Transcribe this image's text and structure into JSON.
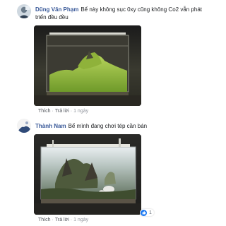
{
  "comments": [
    {
      "author": "Dũng Văn Phạm",
      "text": "Bể này không sục 0xy cũng không Co2 vẫn phát triển đều đều",
      "actions": {
        "like": "Thích",
        "reply": "Trả lời",
        "time": "1 ngày"
      }
    },
    {
      "author": "Thành Nam",
      "text": "Bể mình đang chơi tép cần bán",
      "actions": {
        "like": "Thích",
        "reply": "Trả lời",
        "time": "1 ngày"
      },
      "reaction_count": "1"
    }
  ],
  "colors": {
    "author": "#385898",
    "like_blue": "#1877f2"
  },
  "icons": {
    "reaction": "thumbs-up-icon"
  }
}
